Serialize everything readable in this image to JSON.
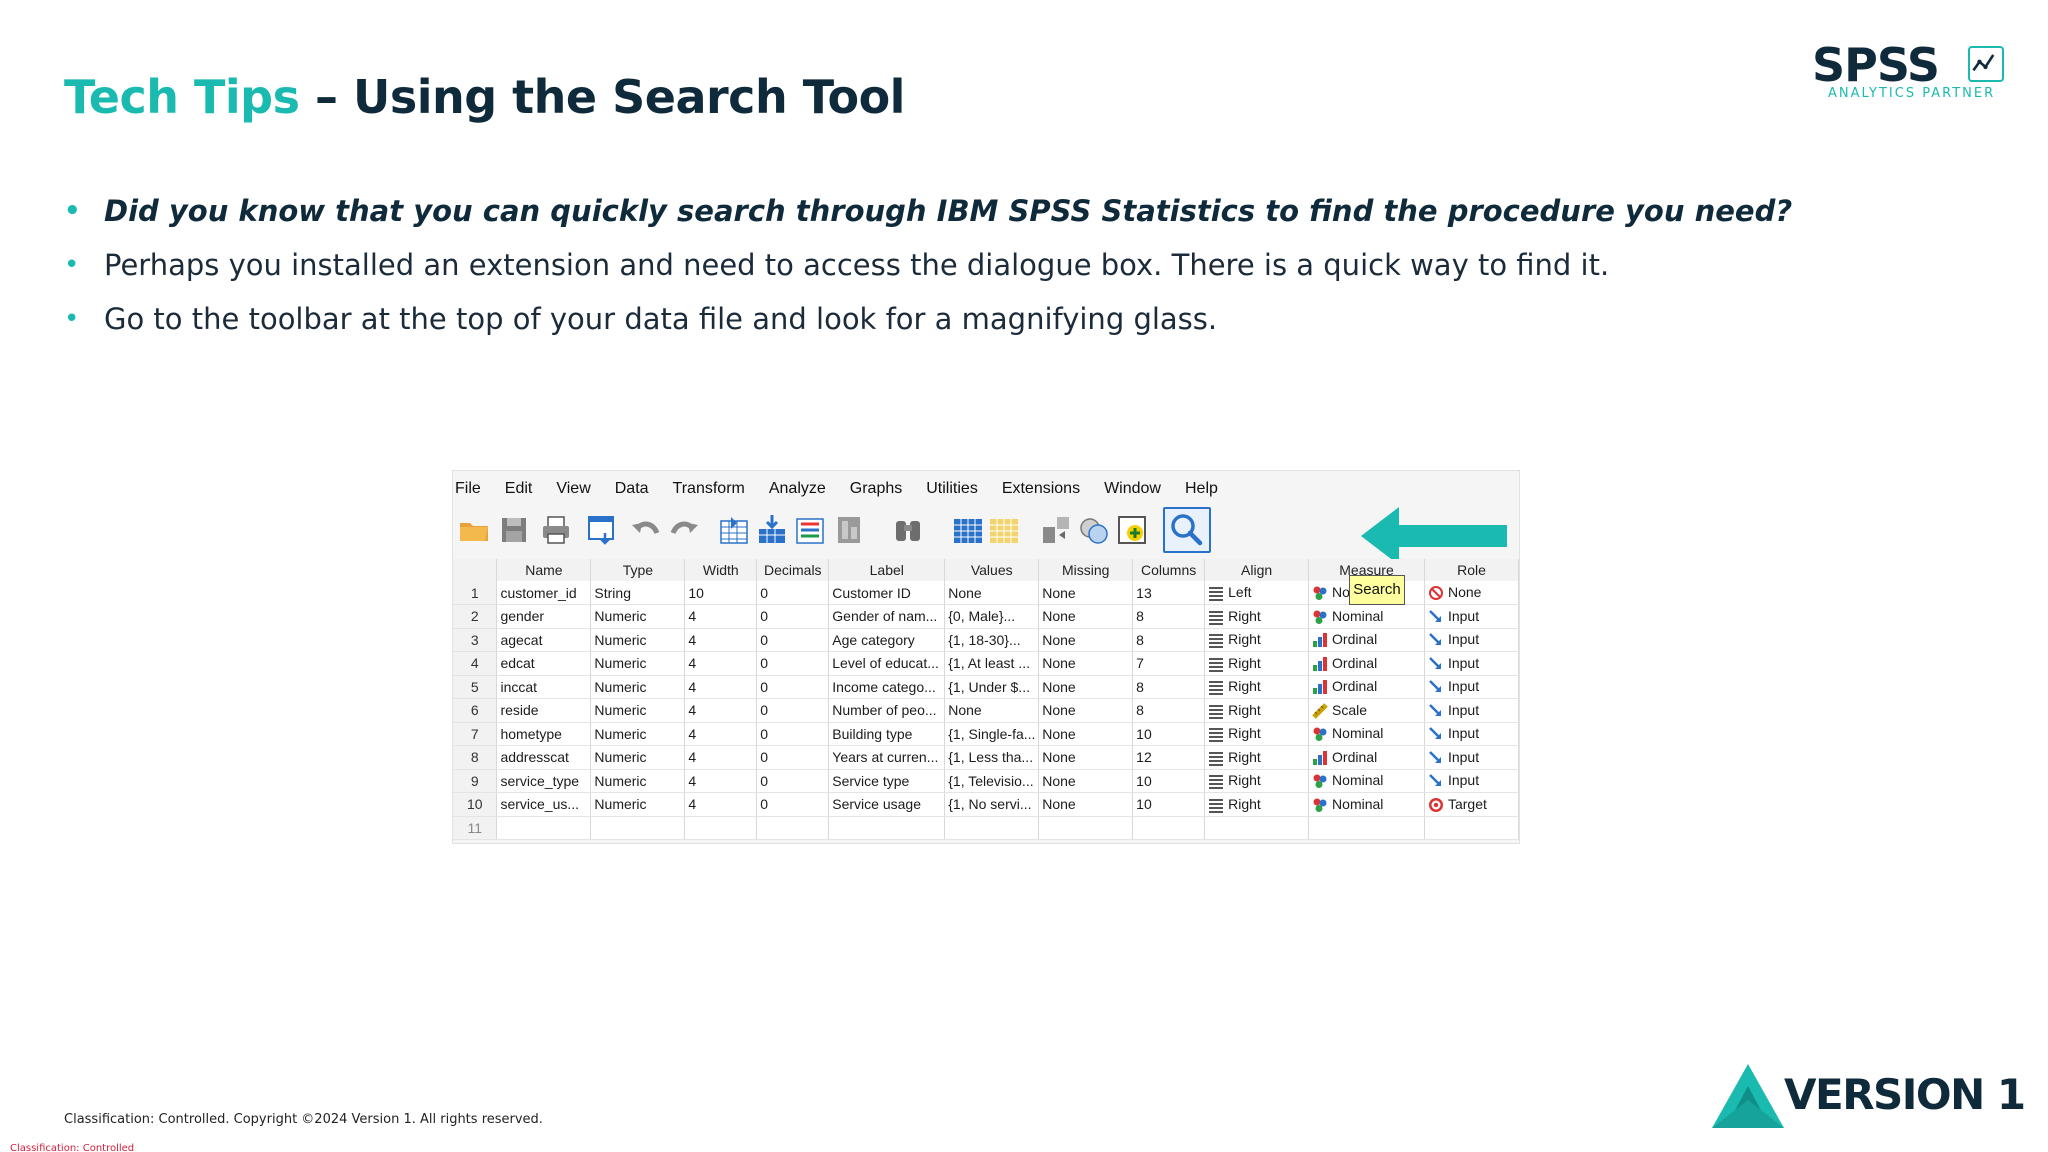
{
  "slide": {
    "title_accent": "Tech Tips",
    "title_rest": " – Using the Search Tool",
    "bullets": [
      "Did you know that you can quickly search through IBM SPSS Statistics to find the procedure you need?",
      "Perhaps you installed an extension and need to access the dialogue box. There is a quick way to find it.",
      "Go to the toolbar at the top of your data file and look for a magnifying glass."
    ],
    "footer_copyright": "Classification: Controlled. Copyright ©2024 Version 1. All rights reserved.",
    "footer_classification": "Classification: Controlled"
  },
  "logos": {
    "spss_word": "SPSS",
    "spss_sub": "ANALYTICS PARTNER",
    "version1_word": "VERSION 1"
  },
  "colors": {
    "accent": "#1bbab0",
    "navy": "#0f2a3a",
    "arrow": "#1bbab0",
    "tooltip_bg": "#ffff9e",
    "classification_red": "#d21f3c"
  },
  "spss": {
    "menu": [
      "File",
      "Edit",
      "View",
      "Data",
      "Transform",
      "Analyze",
      "Graphs",
      "Utilities",
      "Extensions",
      "Window",
      "Help"
    ],
    "toolbar_icons": [
      "open-folder-icon",
      "save-icon",
      "print-icon",
      "dialog-recall-icon",
      "undo-icon",
      "redo-icon",
      "goto-case-icon",
      "goto-variable-icon",
      "variables-icon",
      "run-descriptives-icon",
      "find-icon",
      "insert-cases-icon",
      "insert-variable-icon",
      "split-file-icon",
      "weight-cases-icon",
      "select-cases-icon",
      "search-icon"
    ],
    "tooltip": "Search",
    "headers": [
      "",
      "Name",
      "Type",
      "Width",
      "Decimals",
      "Label",
      "Values",
      "Missing",
      "Columns",
      "Align",
      "Measure",
      "Role"
    ],
    "rows": [
      {
        "n": "1",
        "name": "customer_id",
        "type": "String",
        "width": "10",
        "dec": "0",
        "label": "Customer ID",
        "values": "None",
        "missing": "None",
        "columns": "13",
        "align": "Left",
        "measure": "Nominal",
        "mtype": "nominal",
        "role": "None",
        "rtype": "none"
      },
      {
        "n": "2",
        "name": "gender",
        "type": "Numeric",
        "width": "4",
        "dec": "0",
        "label": "Gender of nam...",
        "values": "{0, Male}...",
        "missing": "None",
        "columns": "8",
        "align": "Right",
        "measure": "Nominal",
        "mtype": "nominal",
        "role": "Input",
        "rtype": "input"
      },
      {
        "n": "3",
        "name": "agecat",
        "type": "Numeric",
        "width": "4",
        "dec": "0",
        "label": "Age category",
        "values": "{1, 18-30}...",
        "missing": "None",
        "columns": "8",
        "align": "Right",
        "measure": "Ordinal",
        "mtype": "ordinal",
        "role": "Input",
        "rtype": "input"
      },
      {
        "n": "4",
        "name": "edcat",
        "type": "Numeric",
        "width": "4",
        "dec": "0",
        "label": "Level of educat...",
        "values": "{1, At least ...",
        "missing": "None",
        "columns": "7",
        "align": "Right",
        "measure": "Ordinal",
        "mtype": "ordinal",
        "role": "Input",
        "rtype": "input"
      },
      {
        "n": "5",
        "name": "inccat",
        "type": "Numeric",
        "width": "4",
        "dec": "0",
        "label": "Income catego...",
        "values": "{1, Under $...",
        "missing": "None",
        "columns": "8",
        "align": "Right",
        "measure": "Ordinal",
        "mtype": "ordinal",
        "role": "Input",
        "rtype": "input"
      },
      {
        "n": "6",
        "name": "reside",
        "type": "Numeric",
        "width": "4",
        "dec": "0",
        "label": "Number of peo...",
        "values": "None",
        "missing": "None",
        "columns": "8",
        "align": "Right",
        "measure": "Scale",
        "mtype": "scale",
        "role": "Input",
        "rtype": "input"
      },
      {
        "n": "7",
        "name": "hometype",
        "type": "Numeric",
        "width": "4",
        "dec": "0",
        "label": "Building type",
        "values": "{1, Single-fa...",
        "missing": "None",
        "columns": "10",
        "align": "Right",
        "measure": "Nominal",
        "mtype": "nominal",
        "role": "Input",
        "rtype": "input"
      },
      {
        "n": "8",
        "name": "addresscat",
        "type": "Numeric",
        "width": "4",
        "dec": "0",
        "label": "Years at curren...",
        "values": "{1, Less tha...",
        "missing": "None",
        "columns": "12",
        "align": "Right",
        "measure": "Ordinal",
        "mtype": "ordinal",
        "role": "Input",
        "rtype": "input"
      },
      {
        "n": "9",
        "name": "service_type",
        "type": "Numeric",
        "width": "4",
        "dec": "0",
        "label": "Service type",
        "values": "{1, Televisio...",
        "missing": "None",
        "columns": "10",
        "align": "Right",
        "measure": "Nominal",
        "mtype": "nominal",
        "role": "Input",
        "rtype": "input"
      },
      {
        "n": "10",
        "name": "service_us...",
        "type": "Numeric",
        "width": "4",
        "dec": "0",
        "label": "Service usage",
        "values": "{1, No servi...",
        "missing": "None",
        "columns": "10",
        "align": "Right",
        "measure": "Nominal",
        "mtype": "nominal",
        "role": "Target",
        "rtype": "target"
      },
      {
        "n": "11",
        "name": "",
        "type": "",
        "width": "",
        "dec": "",
        "label": "",
        "values": "",
        "missing": "",
        "columns": "",
        "align": "",
        "measure": "",
        "mtype": "",
        "role": "",
        "rtype": ""
      }
    ]
  }
}
